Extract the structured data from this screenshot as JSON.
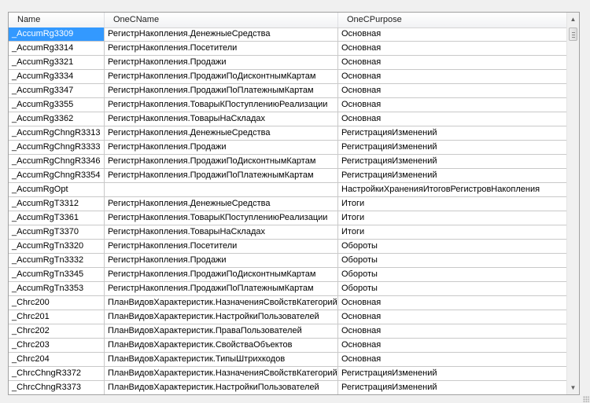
{
  "columns": [
    "Name",
    "OneCName",
    "OneCPurpose"
  ],
  "rows": [
    {
      "name": "_AccumRg3309",
      "onecname": "РегистрНакопления.ДенежныеСредства",
      "purpose": "Основная"
    },
    {
      "name": "_AccumRg3314",
      "onecname": "РегистрНакопления.Посетители",
      "purpose": "Основная"
    },
    {
      "name": "_AccumRg3321",
      "onecname": "РегистрНакопления.Продажи",
      "purpose": "Основная"
    },
    {
      "name": "_AccumRg3334",
      "onecname": "РегистрНакопления.ПродажиПоДисконтнымКартам",
      "purpose": "Основная"
    },
    {
      "name": "_AccumRg3347",
      "onecname": "РегистрНакопления.ПродажиПоПлатежнымКартам",
      "purpose": "Основная"
    },
    {
      "name": "_AccumRg3355",
      "onecname": "РегистрНакопления.ТоварыКПоступлениюРеализации",
      "purpose": "Основная"
    },
    {
      "name": "_AccumRg3362",
      "onecname": "РегистрНакопления.ТоварыНаСкладах",
      "purpose": "Основная"
    },
    {
      "name": "_AccumRgChngR3313",
      "onecname": "РегистрНакопления.ДенежныеСредства",
      "purpose": "РегистрацияИзменений"
    },
    {
      "name": "_AccumRgChngR3333",
      "onecname": "РегистрНакопления.Продажи",
      "purpose": "РегистрацияИзменений"
    },
    {
      "name": "_AccumRgChngR3346",
      "onecname": "РегистрНакопления.ПродажиПоДисконтнымКартам",
      "purpose": "РегистрацияИзменений"
    },
    {
      "name": "_AccumRgChngR3354",
      "onecname": "РегистрНакопления.ПродажиПоПлатежнымКартам",
      "purpose": "РегистрацияИзменений"
    },
    {
      "name": "_AccumRgOpt",
      "onecname": "",
      "purpose": "НастройкиХраненияИтоговРегистровНакопления"
    },
    {
      "name": "_AccumRgT3312",
      "onecname": "РегистрНакопления.ДенежныеСредства",
      "purpose": "Итоги"
    },
    {
      "name": "_AccumRgT3361",
      "onecname": "РегистрНакопления.ТоварыКПоступлениюРеализации",
      "purpose": "Итоги"
    },
    {
      "name": "_AccumRgT3370",
      "onecname": "РегистрНакопления.ТоварыНаСкладах",
      "purpose": "Итоги"
    },
    {
      "name": "_AccumRgTn3320",
      "onecname": "РегистрНакопления.Посетители",
      "purpose": "Обороты"
    },
    {
      "name": "_AccumRgTn3332",
      "onecname": "РегистрНакопления.Продажи",
      "purpose": "Обороты"
    },
    {
      "name": "_AccumRgTn3345",
      "onecname": "РегистрНакопления.ПродажиПоДисконтнымКартам",
      "purpose": "Обороты"
    },
    {
      "name": "_AccumRgTn3353",
      "onecname": "РегистрНакопления.ПродажиПоПлатежнымКартам",
      "purpose": "Обороты"
    },
    {
      "name": "_Chrc200",
      "onecname": "ПланВидовХарактеристик.НазначенияСвойствКатегорий",
      "purpose": "Основная"
    },
    {
      "name": "_Chrc201",
      "onecname": "ПланВидовХарактеристик.НастройкиПользователей",
      "purpose": "Основная"
    },
    {
      "name": "_Chrc202",
      "onecname": "ПланВидовХарактеристик.ПраваПользователей",
      "purpose": "Основная"
    },
    {
      "name": "_Chrc203",
      "onecname": "ПланВидовХарактеристик.СвойстваОбъектов",
      "purpose": "Основная"
    },
    {
      "name": "_Chrc204",
      "onecname": "ПланВидовХарактеристик.ТипыШтрихкодов",
      "purpose": "Основная"
    },
    {
      "name": "_ChrcChngR3372",
      "onecname": "ПланВидовХарактеристик.НазначенияСвойствКатегорий",
      "purpose": "РегистрацияИзменений"
    },
    {
      "name": "_ChrcChngR3373",
      "onecname": "ПланВидовХарактеристик.НастройкиПользователей",
      "purpose": "РегистрацияИзменений"
    }
  ],
  "selected_row": 0,
  "colors": {
    "selection": "#3399ff",
    "gridline": "#c9c9c9",
    "background": "#f0f0f0"
  },
  "icons": {
    "scroll_up": "scroll-up-arrow-icon",
    "scroll_down": "scroll-down-arrow-icon",
    "resize": "resize-grip-icon"
  }
}
